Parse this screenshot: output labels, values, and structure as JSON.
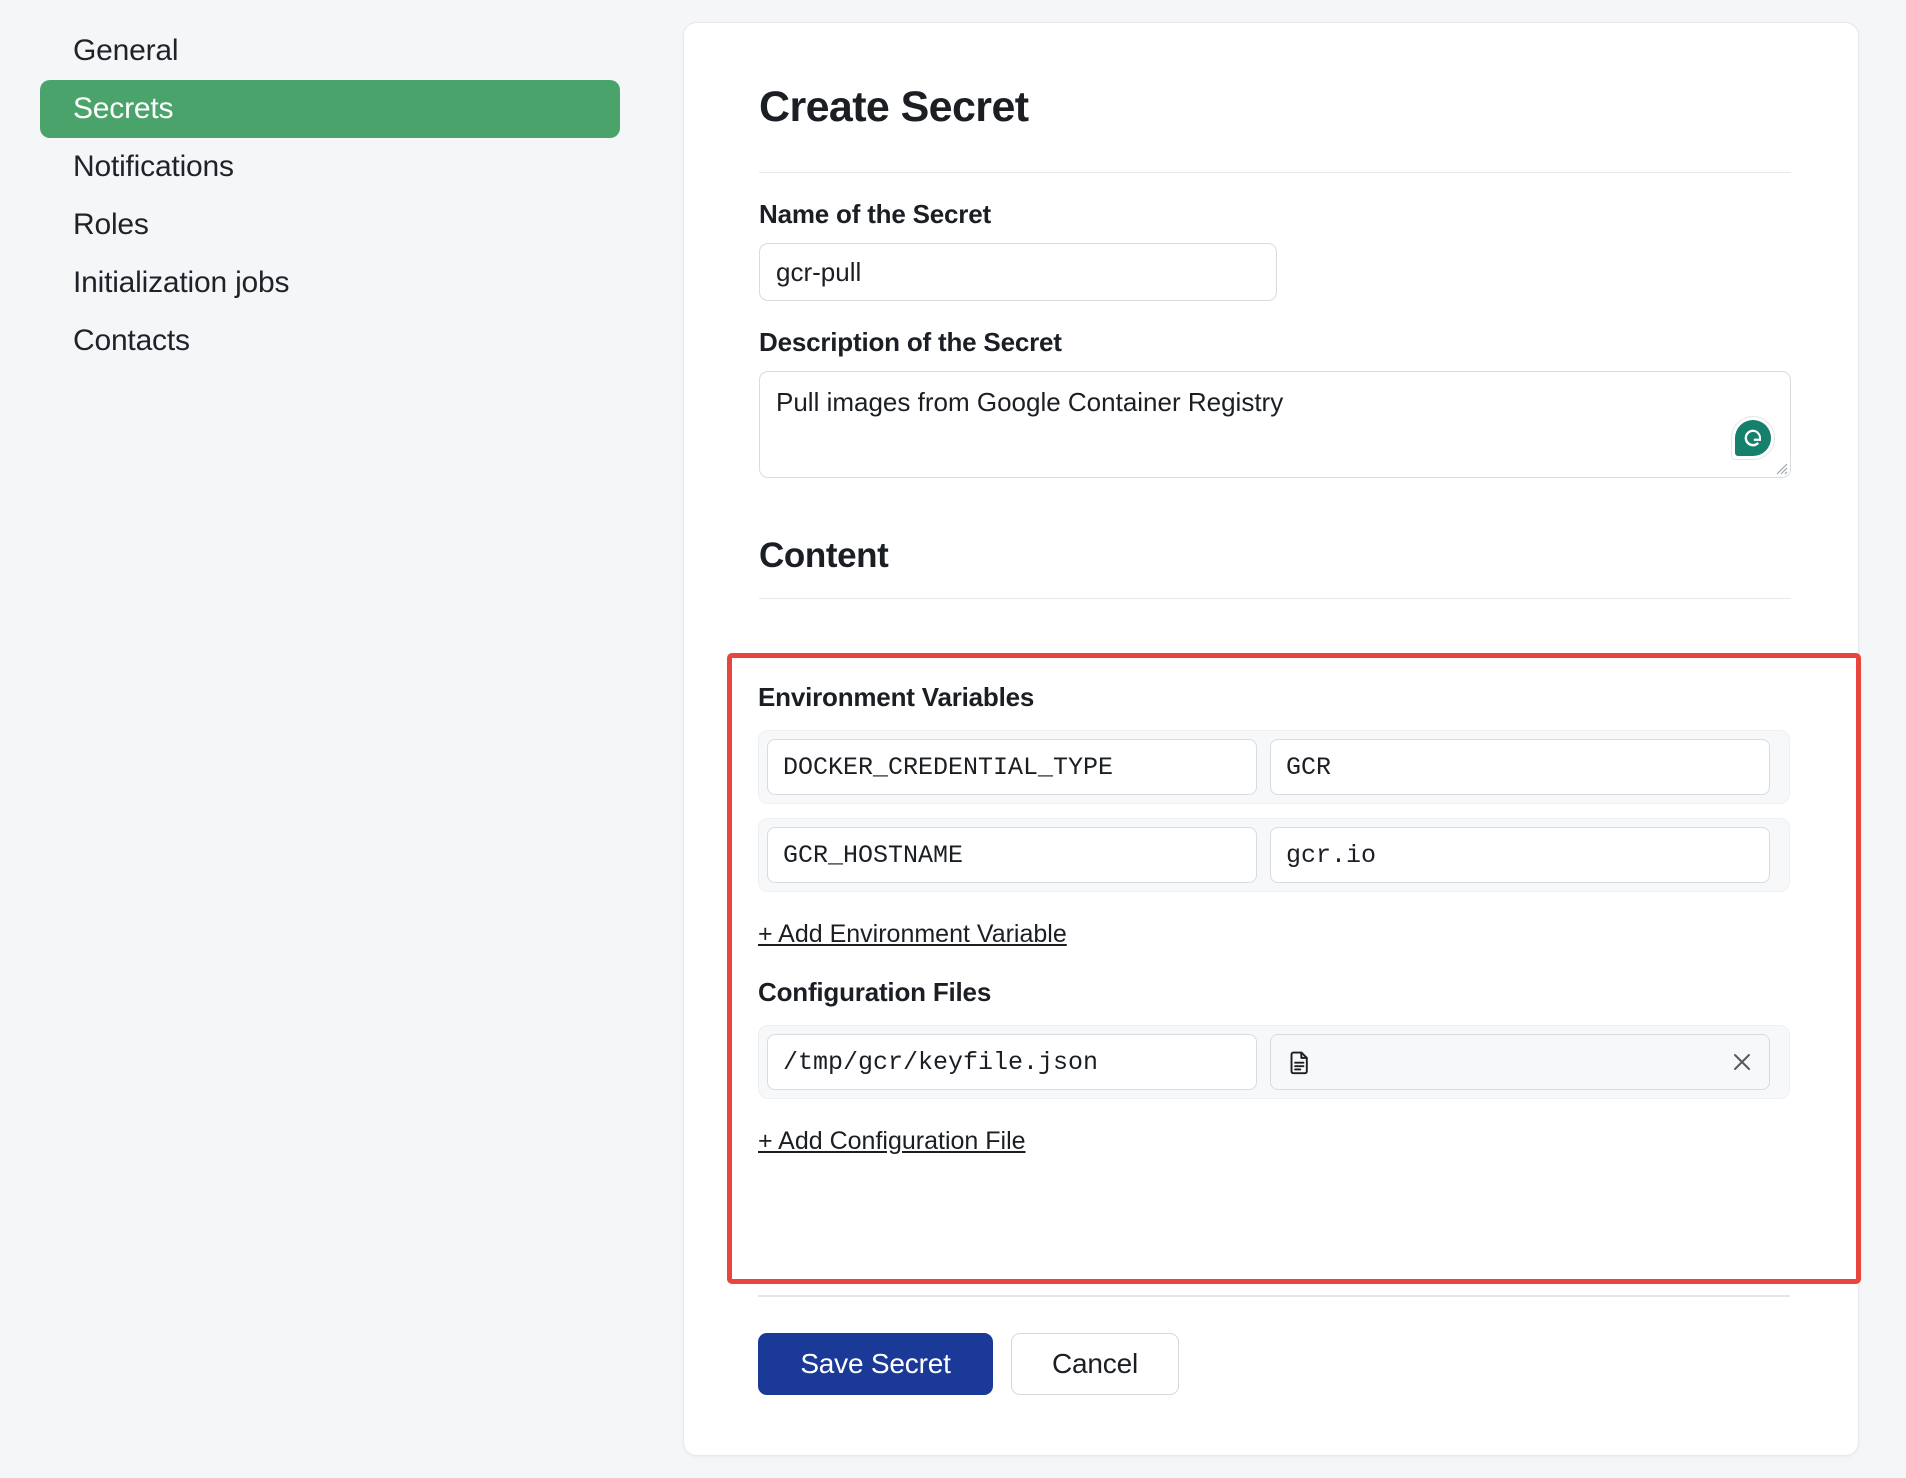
{
  "sidebar": {
    "items": [
      {
        "label": "General",
        "active": false
      },
      {
        "label": "Secrets",
        "active": true
      },
      {
        "label": "Notifications",
        "active": false
      },
      {
        "label": "Roles",
        "active": false
      },
      {
        "label": "Initialization jobs",
        "active": false
      },
      {
        "label": "Contacts",
        "active": false
      }
    ]
  },
  "form": {
    "title": "Create Secret",
    "name_label": "Name of the Secret",
    "name_value": "gcr-pull",
    "name_placeholder": "Name of the Secret",
    "description_label": "Description of the Secret",
    "description_value": "Pull images from Google Container Registry",
    "description_placeholder": "Description of the Secret",
    "grammarly_icon": "grammarly-icon",
    "resize_handle_icon": "resize-grip-icon"
  },
  "content": {
    "heading": "Content",
    "env": {
      "label": "Environment Variables",
      "rows": [
        {
          "key": "DOCKER_CREDENTIAL_TYPE",
          "value": "GCR"
        },
        {
          "key": "GCR_HOSTNAME",
          "value": "gcr.io"
        }
      ],
      "add_label": "+ Add Environment Variable"
    },
    "files": {
      "label": "Configuration Files",
      "rows": [
        {
          "path": "/tmp/gcr/keyfile.json",
          "file_icon": "document-icon",
          "clear_icon": "close-icon",
          "file_name": ""
        }
      ],
      "add_label": "+ Add Configuration File"
    },
    "highlight_color": "#e8453c"
  },
  "actions": {
    "save_label": "Save Secret",
    "cancel_label": "Cancel",
    "save_color": "#1b3a97"
  },
  "theme": {
    "page_background": "#f5f6f8",
    "card_background": "#ffffff",
    "active_nav_color": "#4ba36c",
    "grammarly_color": "#15806b"
  }
}
